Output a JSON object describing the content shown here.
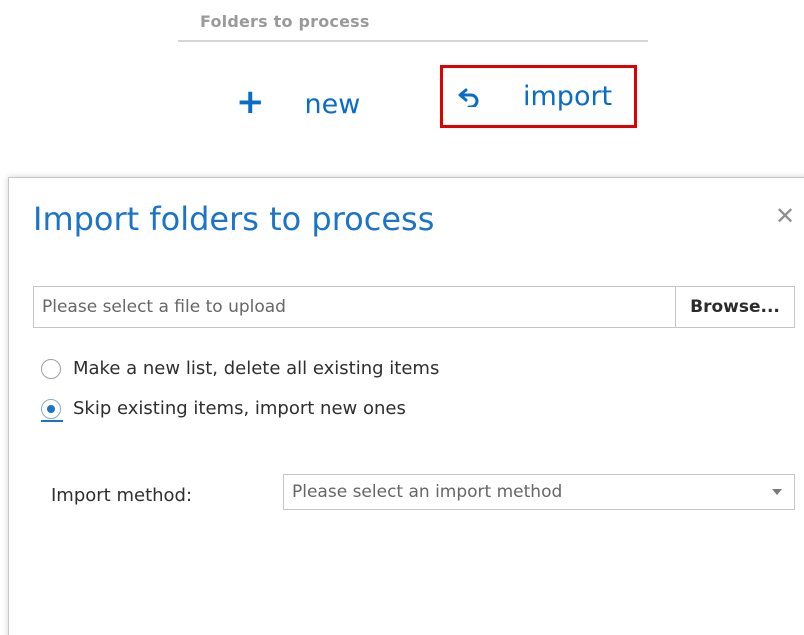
{
  "toolbar": {
    "section_title": "Folders to process",
    "new_label": "new",
    "import_label": "import",
    "accent_color": "#0a6cc7",
    "highlight_color": "#e00000"
  },
  "dialog": {
    "title": "Import folders to process",
    "close_icon": "close-icon",
    "file_placeholder": "Please select a file to upload",
    "browse_label": "Browse...",
    "options": [
      {
        "label": "Make a new list, delete all existing items",
        "checked": false
      },
      {
        "label": "Skip existing items, import new ones",
        "checked": true
      }
    ],
    "method_label": "Import method:",
    "method_placeholder": "Please select an import method"
  }
}
